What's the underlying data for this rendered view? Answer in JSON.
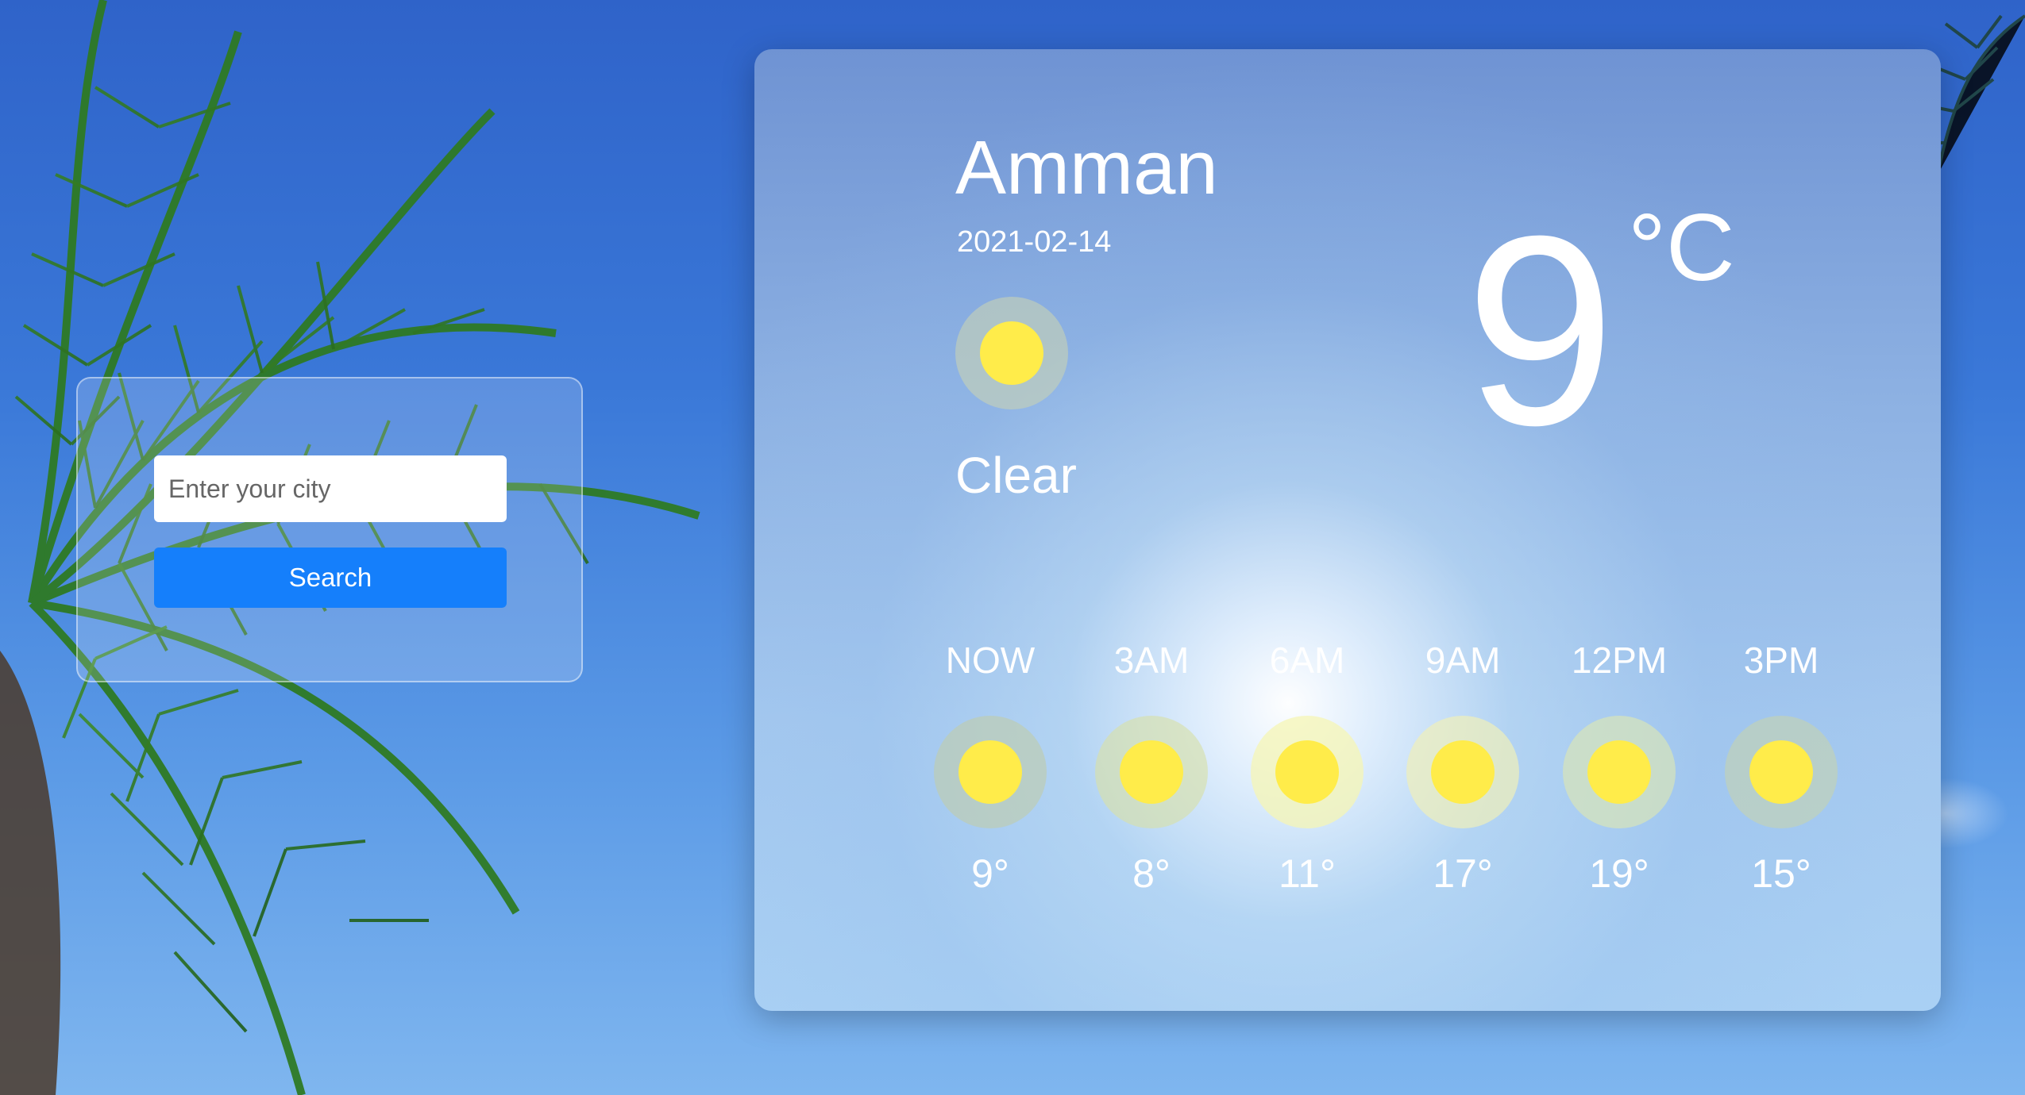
{
  "search": {
    "placeholder": "Enter your city",
    "button_label": "Search"
  },
  "current": {
    "city": "Amman",
    "date": "2021-02-14",
    "condition": "Clear",
    "icon": "sun-icon",
    "temperature": "9",
    "unit": "°C"
  },
  "forecast": [
    {
      "time": "NOW",
      "icon": "sun-icon",
      "temp": "9°"
    },
    {
      "time": "3AM",
      "icon": "sun-icon",
      "temp": "8°"
    },
    {
      "time": "6AM",
      "icon": "sun-icon",
      "temp": "11°"
    },
    {
      "time": "9AM",
      "icon": "sun-icon",
      "temp": "17°"
    },
    {
      "time": "12PM",
      "icon": "sun-icon",
      "temp": "19°"
    },
    {
      "time": "3PM",
      "icon": "sun-icon",
      "temp": "15°"
    }
  ],
  "colors": {
    "accent": "#157ffb",
    "sun": "#ffec4a"
  }
}
